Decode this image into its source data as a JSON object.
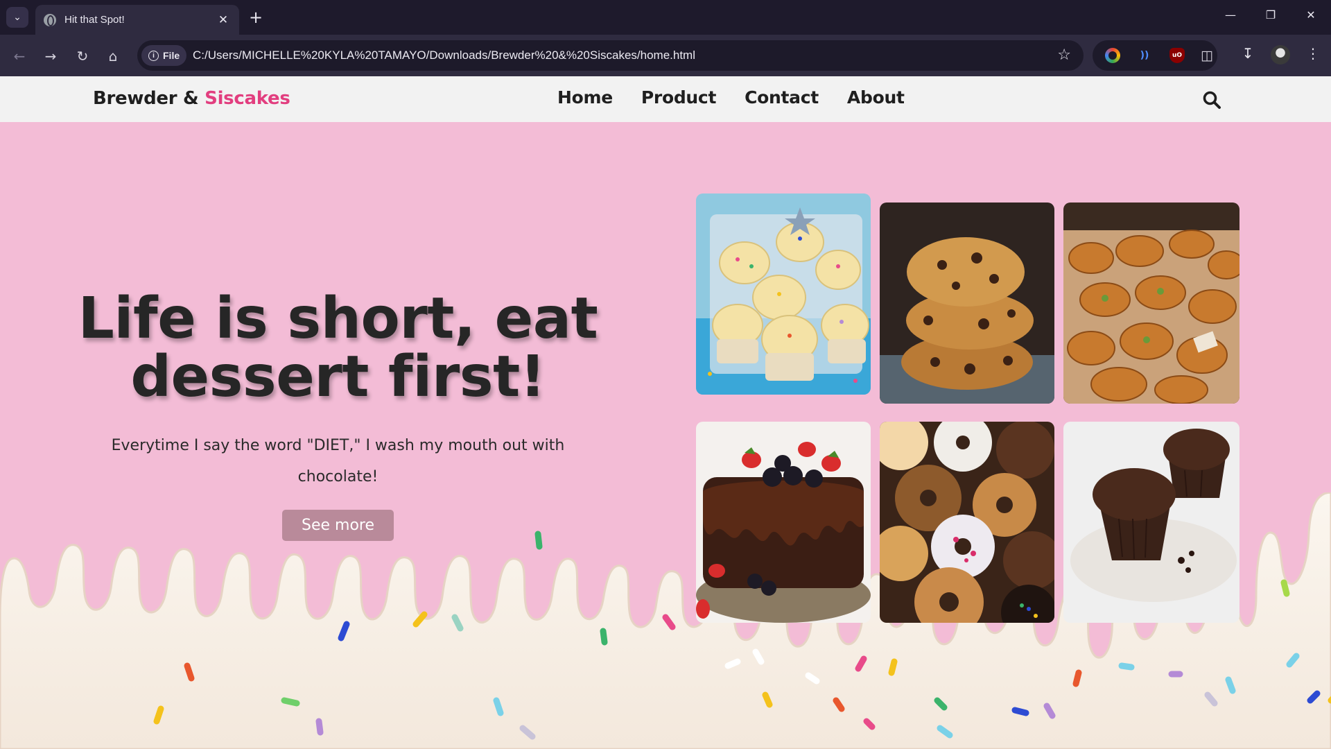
{
  "browser": {
    "tab_title": "Hit that Spot!",
    "new_tab_symbol": "+",
    "site_chip_label": "File",
    "url": "C:/Users/MICHELLE%20KYLA%20TAMAYO/Downloads/Brewder%20&%20Siscakes/home.html"
  },
  "site": {
    "brand_main": "Brewder & ",
    "brand_accent": "Siscakes",
    "accent_color": "#e23e7f",
    "background_color": "#f3bcd6",
    "nav": [
      "Home",
      "Product",
      "Contact",
      "About"
    ]
  },
  "hero": {
    "title": "Life is short, eat dessert first!",
    "subtitle": "Everytime I say the word \"DIET,\" I wash my mouth out with chocolate!",
    "button_label": "See more"
  },
  "gallery": [
    {
      "subject": "cupcakes"
    },
    {
      "subject": "chocolate chip cookies"
    },
    {
      "subject": "pastries"
    },
    {
      "subject": "chocolate cake with berries"
    },
    {
      "subject": "donuts"
    },
    {
      "subject": "chocolate muffins"
    }
  ]
}
